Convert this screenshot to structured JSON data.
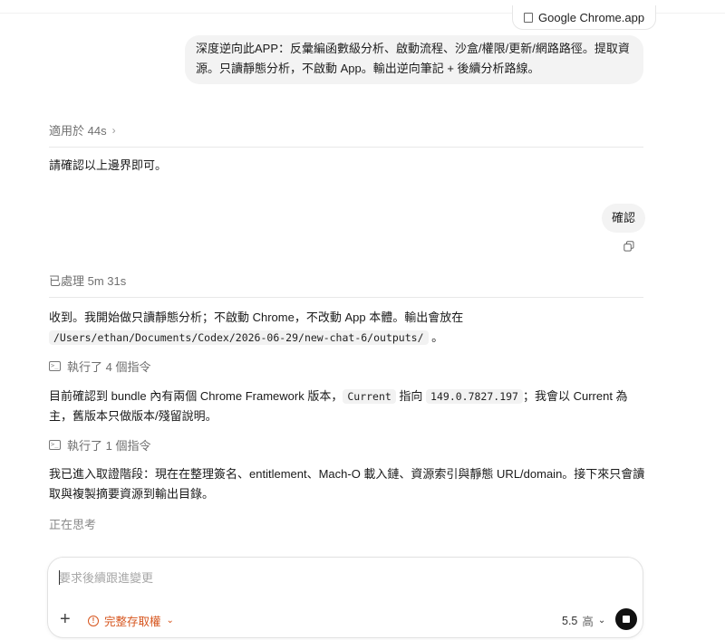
{
  "attachment": {
    "label": "Google Chrome.app"
  },
  "messages": {
    "user_1": "深度逆向此APP：反彙編函數級分析、啟動流程、沙盒/權限/更新/網路路徑。提取資源。只讀靜態分析，不啟動 App。輸出逆向筆記 + 後續分析路線。",
    "section_1": "適用於 44s",
    "assistant_1": "請確認以上邊界即可。",
    "user_2": "確認",
    "section_2": "已處理 5m 31s",
    "assistant_2": {
      "text_before": "收到。我開始做只讀靜態分析；不啟動 Chrome，不改動 App 本體。輸出會放在",
      "path": "/Users/ethan/Documents/Codex/2026-06-29/new-chat-6/outputs/",
      "text_after": "。"
    },
    "commands_1": "執行了 4 個指令",
    "assistant_3": {
      "text_1": "目前確認到 bundle 內有兩個 Chrome Framework 版本，",
      "code_1": "Current",
      "text_2": " 指向 ",
      "code_2": "149.0.7827.197",
      "text_3": "；我會以 Current 為主，舊版本只做版本/殘留說明。"
    },
    "commands_2": "執行了 1 個指令",
    "assistant_4": "我已進入取證階段：現在在整理簽名、entitlement、Mach-O 載入鏈、資源索引與靜態 URL/domain。接下來只會讀取與複製摘要資源到輸出目錄。",
    "thinking": "正在思考"
  },
  "composer": {
    "placeholder": "要求後續跟進變更",
    "access_label": "完整存取權",
    "model_label": "5.5",
    "level_label": "高"
  },
  "icons": {
    "attachment": "file-icon",
    "copy": "copy-icon",
    "terminal": "terminal-icon",
    "plus": "plus-icon",
    "warning": "warning-icon",
    "stop": "stop-icon"
  },
  "colors": {
    "accent_warning": "#d6541c",
    "bubble": "#f3f3f3",
    "stop_button": "#111111"
  }
}
